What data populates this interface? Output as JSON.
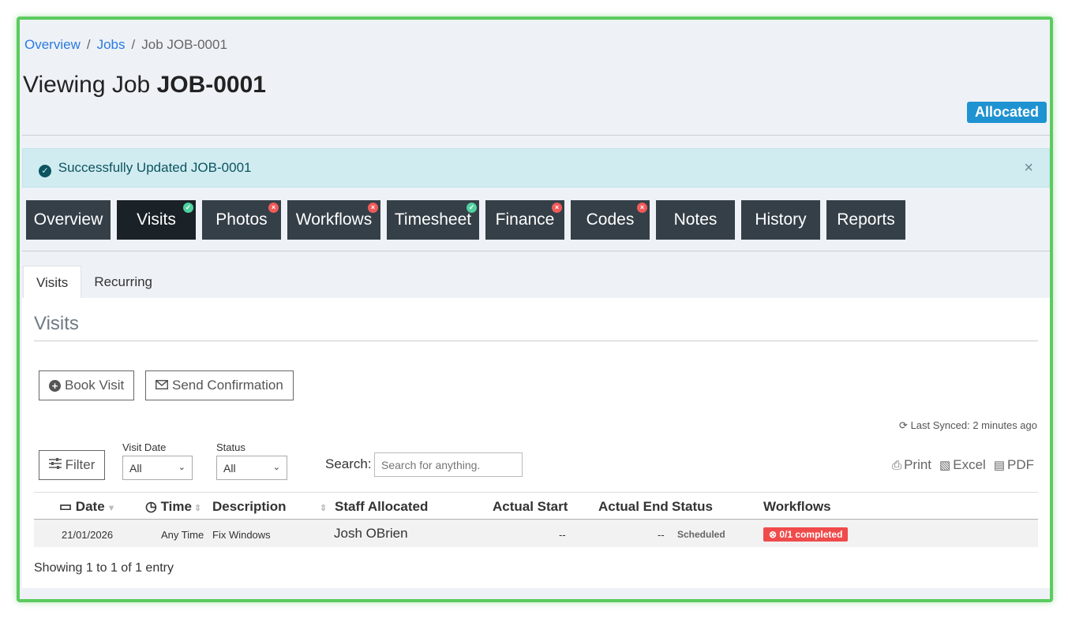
{
  "breadcrumb": {
    "items": [
      "Overview",
      "Jobs",
      "Job JOB-0001"
    ],
    "sep": "/"
  },
  "page": {
    "title_prefix": "Viewing Job ",
    "title_job": "JOB-0001",
    "status": "Allocated",
    "status_color": "#1f93d1"
  },
  "alert": {
    "text": "Successfully Updated JOB-0001",
    "close": "×"
  },
  "tabs": [
    {
      "label": "Overview",
      "mark": ""
    },
    {
      "label": "Visits",
      "mark": "ok"
    },
    {
      "label": "Photos",
      "mark": "err"
    },
    {
      "label": "Workflows",
      "mark": "err"
    },
    {
      "label": "Timesheet",
      "mark": "ok"
    },
    {
      "label": "Finance",
      "mark": "err"
    },
    {
      "label": "Codes",
      "mark": "err"
    },
    {
      "label": "Notes",
      "mark": ""
    },
    {
      "label": "History",
      "mark": ""
    },
    {
      "label": "Reports",
      "mark": ""
    }
  ],
  "subtabs": [
    "Visits",
    "Recurring"
  ],
  "section": {
    "title": "Visits"
  },
  "buttons": {
    "book_visit": "Book Visit",
    "send_confirmation": "Send Confirmation"
  },
  "sync": {
    "text": "Last Synced: 2 minutes ago"
  },
  "filters": {
    "filter_label": "Filter",
    "visit_date_label": "Visit Date",
    "visit_date_value": "All",
    "status_label": "Status",
    "status_value": "All",
    "search_label": "Search:",
    "search_placeholder": "Search for anything."
  },
  "exports": {
    "print": "Print",
    "excel": "Excel",
    "pdf": "PDF"
  },
  "table": {
    "headers": [
      "Date",
      "Time",
      "Description",
      "Staff Allocated",
      "Actual Start",
      "Actual End",
      "Status",
      "Workflows"
    ],
    "rows": [
      {
        "date": "21/01/2026",
        "time": "Any Time",
        "description": "Fix Windows",
        "staff": "Josh OBrien",
        "actual_start": "--",
        "actual_end": "--",
        "status": "Scheduled",
        "workflows": "0/1 completed"
      }
    ],
    "footer": "Showing 1 to 1 of 1 entry"
  }
}
